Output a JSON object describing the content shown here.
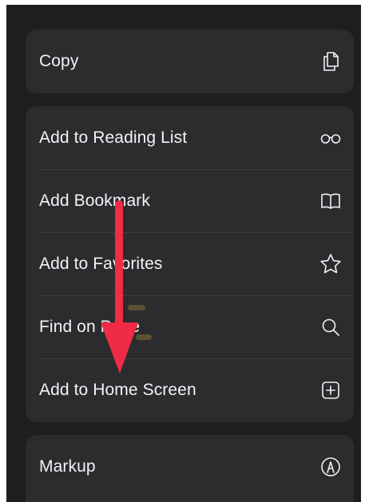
{
  "menu": {
    "copy_group": [
      {
        "label": "Copy",
        "icon": "copy-icon"
      }
    ],
    "main_group": [
      {
        "label": "Add to Reading List",
        "icon": "reading-glasses-icon"
      },
      {
        "label": "Add Bookmark",
        "icon": "book-icon"
      },
      {
        "label": "Add to Favorites",
        "icon": "star-icon"
      },
      {
        "label": "Find on Page",
        "icon": "search-icon"
      },
      {
        "label": "Add to Home Screen",
        "icon": "add-square-icon"
      }
    ],
    "markup_group": [
      {
        "label": "Markup",
        "icon": "markup-pen-icon"
      }
    ]
  },
  "colors": {
    "background": "#1e1e1f",
    "row_background": "#2c2c2e",
    "text": "#f2f2f7",
    "annotation_arrow": "#ef2b45"
  }
}
